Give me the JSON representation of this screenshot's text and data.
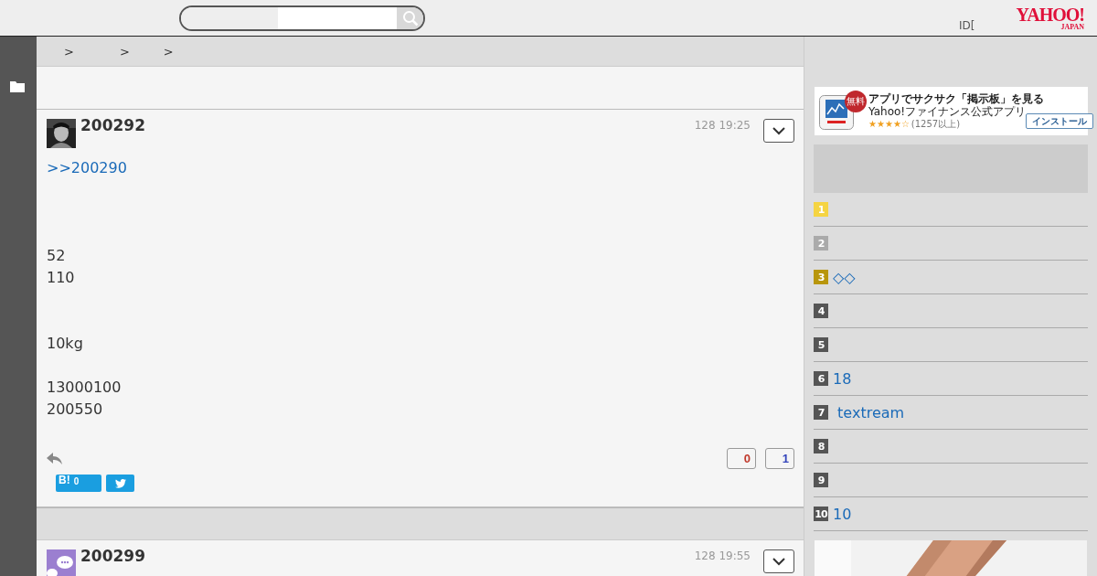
{
  "header": {
    "login": "ID[",
    "logo": {
      "name": "YAHOO!",
      "sub": "JAPAN"
    }
  },
  "breadcrumb": [
    ">",
    ">",
    ">"
  ],
  "posts": [
    {
      "avatar": {
        "kind": "picture"
      },
      "number": "200292",
      "time": "128 19:25",
      "body": [
        {
          "kind": "link",
          "lines": [
            ">>200290"
          ]
        },
        {
          "kind": "text",
          "lines": [
            "52",
            "110"
          ]
        },
        {
          "kind": "text",
          "lines": [
            "10kg"
          ]
        },
        {
          "kind": "text",
          "lines": [
            "13000100",
            "200550"
          ]
        }
      ],
      "votes": [
        "0",
        "1"
      ],
      "hatena_label": "B!",
      "hatena_count": "0"
    },
    {
      "avatar": {
        "kind": "icon"
      },
      "number": "200299",
      "time": "128 19:55"
    }
  ],
  "ad": {
    "badge": "無料",
    "title": "アプリでサクサク「掲示板」を見る",
    "subtitle": "Yahoo!ファイナンス公式アプリ",
    "stars": 4,
    "reviews": "(1257以上)",
    "button": "インストール"
  },
  "ranking": [
    {
      "rank": "1",
      "color": "#f5d442"
    },
    {
      "rank": "2",
      "color": "#aaaaaa"
    },
    {
      "rank": "3",
      "color": "#b8960c",
      "title": "◇◇"
    },
    {
      "rank": "4",
      "color": "#555555"
    },
    {
      "rank": "5",
      "color": "#555555"
    },
    {
      "rank": "6",
      "color": "#555555",
      "title": "18"
    },
    {
      "rank": "7",
      "color": "#555555",
      "title": " textream"
    },
    {
      "rank": "8",
      "color": "#555555"
    },
    {
      "rank": "9",
      "color": "#555555"
    },
    {
      "rank": "10",
      "color": "#555555",
      "title": "10"
    }
  ],
  "side_picture": {
    "kind": "picture"
  }
}
